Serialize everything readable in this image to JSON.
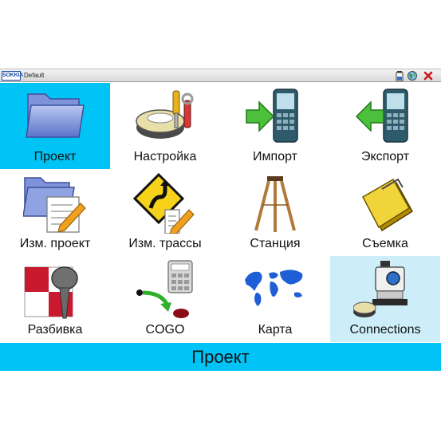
{
  "window": {
    "logo_text": "SOKKIA",
    "title": "Default",
    "icons": [
      "battery-icon",
      "globe-icon",
      "close-icon"
    ]
  },
  "colors": {
    "selected": "#00c4f5",
    "hover": "#cdeef9",
    "footer": "#00c4f5",
    "close": "#d01818"
  },
  "tiles": [
    {
      "label": "Проект",
      "icon": "folder-icon",
      "state": "selected"
    },
    {
      "label": "Настройка",
      "icon": "settings-tools-icon",
      "state": "normal"
    },
    {
      "label": "Импорт",
      "icon": "import-icon",
      "state": "normal"
    },
    {
      "label": "Экспорт",
      "icon": "export-icon",
      "state": "normal"
    },
    {
      "label": "Изм. проект",
      "icon": "edit-project-icon",
      "state": "normal"
    },
    {
      "label": "Изм. трассы",
      "icon": "road-sign-icon",
      "state": "normal"
    },
    {
      "label": "Станция",
      "icon": "tripod-icon",
      "state": "normal"
    },
    {
      "label": "Съемка",
      "icon": "field-book-icon",
      "state": "normal"
    },
    {
      "label": "Разбивка",
      "icon": "stakeout-icon",
      "state": "normal"
    },
    {
      "label": "COGO",
      "icon": "cogo-icon",
      "state": "normal"
    },
    {
      "label": "Карта",
      "icon": "world-map-icon",
      "state": "normal"
    },
    {
      "label": "Connections",
      "icon": "total-station-icon",
      "state": "hover"
    }
  ],
  "footer": {
    "text": "Проект"
  }
}
